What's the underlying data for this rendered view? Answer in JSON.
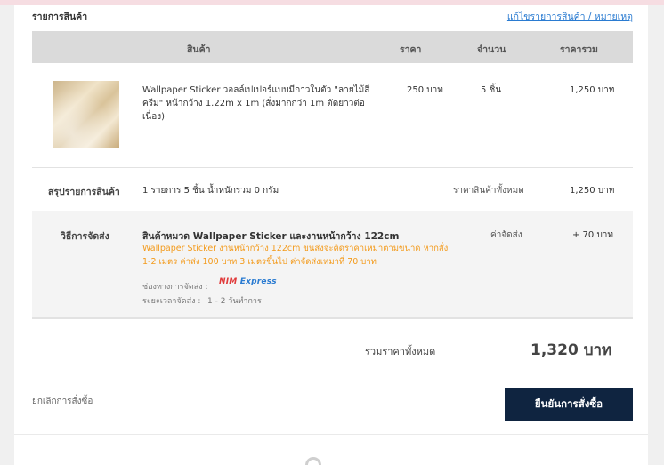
{
  "section": {
    "title": "รายการสินค้า",
    "edit_link": "แก้ไขรายการสินค้า / หมายเหตุ"
  },
  "table": {
    "headers": [
      "สินค้า",
      "ราคา",
      "จำนวน",
      "ราคารวม"
    ]
  },
  "item": {
    "name": "Wallpaper Sticker วอลล์เปเปอร์แบบมีกาวในตัว \"ลายไม้สีครีม\" หน้ากว้าง 1.22m x 1m (สั่งมากกว่า 1m ตัดยาวต่อเนื่อง)",
    "price": "250 บาท",
    "qty": "5 ชิ้น",
    "total": "1,250 บาท"
  },
  "summary": {
    "title": "สรุปรายการสินค้า",
    "detail": "1 รายการ 5 ชิ้น น้ำหนักรวม 0 กรัม",
    "label": "ราคาสินค้าทั้งหมด",
    "value": "1,250 บาท"
  },
  "shipping": {
    "label": "วิธีการจัดส่ง",
    "category": "สินค้าหมวด Wallpaper Sticker และงานหน้ากว้าง 122cm",
    "note": "Wallpaper Sticker งานหน้ากว้าง 122cm ขนส่งจะคิดราคาเหมาตามขนาด หากสั่ง 1-2 เมตร ค่าส่ง 100 บาท 3 เมตรขึ้นไป ค่าจัดส่งเหมาที่ 70 บาท",
    "channel_label": "ช่องทางการจัดส่ง :",
    "carrier_a": "NIM",
    "carrier_b": "Express",
    "duration_label": "ระยะเวลาจัดส่ง :",
    "duration_value": "1 - 2 วันทำการ",
    "fee_label": "ค่าจัดส่ง",
    "fee_value": "+ 70 บาท"
  },
  "total": {
    "label": "รวมราคาทั้งหมด",
    "value": "1,320 บาท"
  },
  "actions": {
    "cancel": "ยกเลิกการสั่งซื้อ",
    "confirm": "ยืนยันการสั่งซื้อ"
  },
  "colors": {
    "accent": "#0f2440",
    "link": "#2a7bd1",
    "note": "#f39a1a"
  }
}
